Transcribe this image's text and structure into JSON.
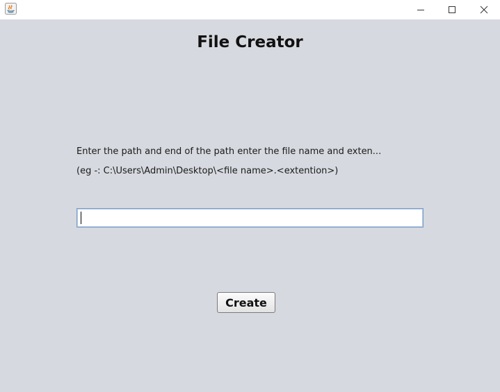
{
  "window": {
    "title_bar_icon": "java-app-icon",
    "controls": {
      "minimize_icon": "minimize-icon",
      "maximize_icon": "maximize-icon",
      "close_icon": "close-icon"
    }
  },
  "main": {
    "title": "File Creator",
    "instruction_line1": "Enter the path and end of the path enter the file name and exten...",
    "instruction_line2": "(eg -: C:\\Users\\Admin\\Desktop\\<file name>.<extention>)",
    "path_input": {
      "value": "",
      "placeholder": ""
    },
    "create_label": "Create"
  },
  "colors": {
    "background": "#d6d9df",
    "titlebar": "#ffffff",
    "input_border": "#7a9cc6"
  }
}
